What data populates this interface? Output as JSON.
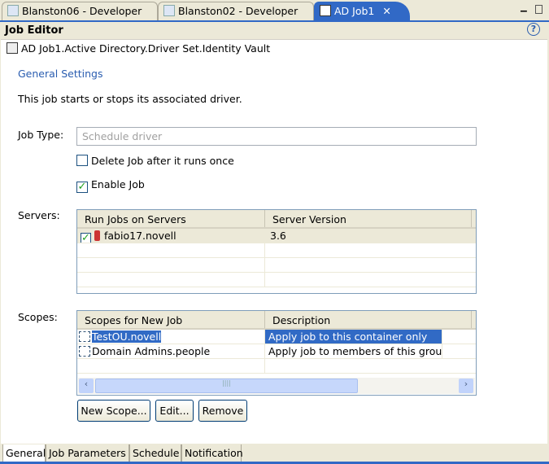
{
  "tabs": [
    {
      "label": "Blanston06 - Developer"
    },
    {
      "label": "Blanston02 - Developer"
    },
    {
      "label": "AD Job1",
      "active": true
    }
  ],
  "header": {
    "title": "Job Editor",
    "help": "?"
  },
  "object_path": "AD Job1.Active Directory.Driver Set.Identity Vault",
  "section_link": "General Settings",
  "description": "This job starts or stops its associated driver.",
  "job_type": {
    "label": "Job Type:",
    "value": "Schedule driver"
  },
  "delete_job": {
    "label": "Delete Job after it runs once",
    "checked": false
  },
  "enable_job": {
    "label": "Enable Job",
    "checked": true
  },
  "servers": {
    "label": "Servers:",
    "columns": [
      "Run Jobs on Servers",
      "Server Version"
    ],
    "rows": [
      {
        "name": "fabio17.novell",
        "version": "3.6",
        "checked": true
      }
    ]
  },
  "scopes": {
    "label": "Scopes:",
    "columns": [
      "Scopes for New Job",
      "Description"
    ],
    "rows": [
      {
        "name": "TestOU.novell",
        "description": "Apply job to this container only",
        "selected": true
      },
      {
        "name": "Domain Admins.people",
        "description": "Apply job to members of this group"
      }
    ]
  },
  "buttons": {
    "new_scope": "New Scope...",
    "edit": "Edit...",
    "remove": "Remove"
  },
  "bottom_tabs": [
    "General",
    "Job Parameters",
    "Schedule",
    "Notification"
  ]
}
